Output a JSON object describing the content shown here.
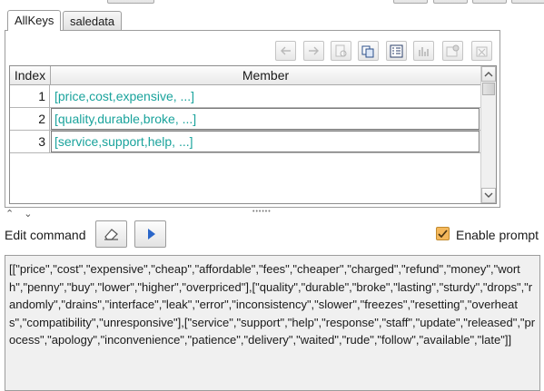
{
  "tabs": [
    {
      "label": "AllKeys",
      "active": true
    },
    {
      "label": "saledata",
      "active": false
    }
  ],
  "toolbar": {
    "icons": [
      "back-arrow-icon",
      "forward-arrow-icon",
      "document-search-icon",
      "copy-icon",
      "list-view-icon",
      "bar-chart-icon",
      "properties-icon",
      "clear-filter-icon"
    ]
  },
  "table": {
    "columns": [
      "Index",
      "Member"
    ],
    "rows": [
      {
        "index": "1",
        "member": "[price,cost,expensive, ...]"
      },
      {
        "index": "2",
        "member": "[quality,durable,broke, ...]"
      },
      {
        "index": "3",
        "member": "[service,support,help, ...]"
      }
    ]
  },
  "splitter": {
    "arrows": "⌃ ⌄",
    "grip": "••••••"
  },
  "command": {
    "label": "Edit command",
    "enable_prompt_label": "Enable prompt",
    "enable_prompt_checked": true,
    "text": "[[\"price\",\"cost\",\"expensive\",\"cheap\",\"affordable\",\"fees\",\"cheaper\",\"charged\",\"refund\",\"money\",\"worth\",\"penny\",\"buy\",\"lower\",\"higher\",\"overpriced\"],[\"quality\",\"durable\",\"broke\",\"lasting\",\"sturdy\",\"drops\",\"randomly\",\"drains\",\"interface\",\"leak\",\"error\",\"inconsistency\",\"slower\",\"freezes\",\"resetting\",\"overheats\",\"compatibility\",\"unresponsive\"],[\"service\",\"support\",\"help\",\"response\",\"staff\",\"update\",\"released\",\"process\",\"apology\",\"inconvenience\",\"patience\",\"delivery\",\"waited\",\"rude\",\"follow\",\"available\",\"late\"]]"
  },
  "colors": {
    "member_text": "#1aa39c",
    "checkbox": "#e8a33a"
  }
}
